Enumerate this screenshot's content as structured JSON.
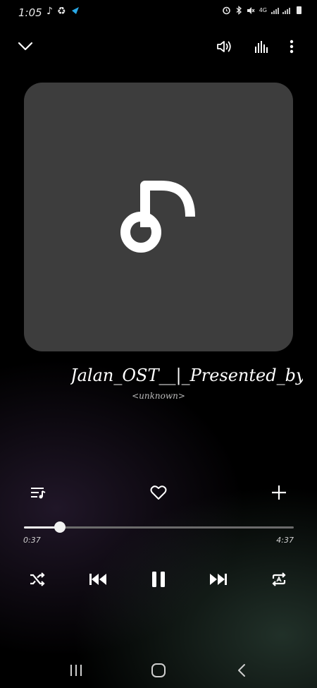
{
  "status_bar": {
    "time": "1:05",
    "network_label": "4G",
    "icons": [
      "music-note-icon",
      "sync-icon",
      "signal-arrow-icon",
      "alarm-icon",
      "bluetooth-icon",
      "mute-icon",
      "signal-icon",
      "battery-icon"
    ]
  },
  "header": {
    "icons": [
      "chevron-down-icon",
      "volume-icon",
      "equalizer-icon",
      "more-vert-icon"
    ]
  },
  "track": {
    "title": "Jalan_OST__|_Presented_by",
    "artist": "<unknown>"
  },
  "actions": {
    "icons": [
      "playlist-icon",
      "heart-icon",
      "add-icon"
    ]
  },
  "progress": {
    "current": "0:37",
    "total": "4:37",
    "fraction": 0.133
  },
  "controls": {
    "icons": [
      "shuffle-icon",
      "previous-icon",
      "pause-icon",
      "next-icon",
      "repeat-icon"
    ]
  },
  "nav": {
    "icons": [
      "recent-apps-icon",
      "home-icon",
      "back-icon"
    ]
  },
  "colors": {
    "background": "#000000",
    "art_tile": "#3d3d3d",
    "accent": "#f2f2f2"
  }
}
